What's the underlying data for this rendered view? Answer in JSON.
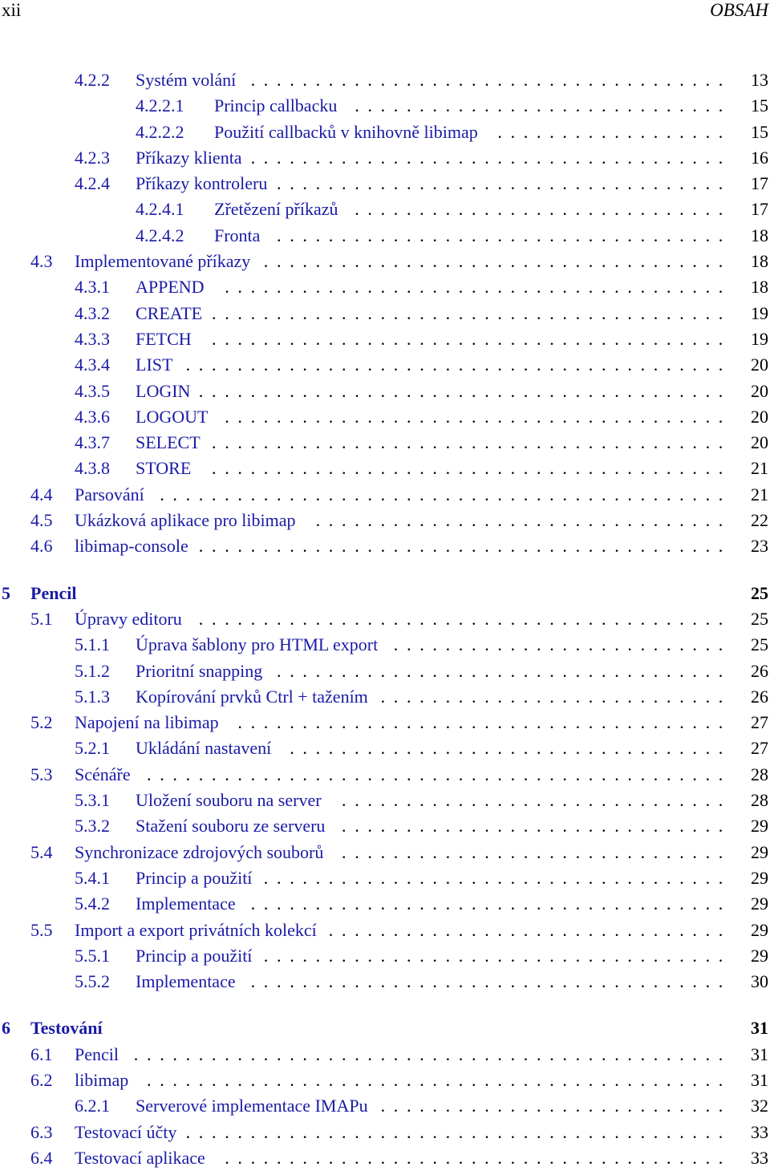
{
  "header": {
    "page_number": "xii",
    "running_title": "OBSAH"
  },
  "toc": [
    {
      "level": 3,
      "num": "4.2.2",
      "title": "Systém volání",
      "page": "13"
    },
    {
      "level": 4,
      "num": "4.2.2.1",
      "title": "Princip callbacku",
      "page": "15"
    },
    {
      "level": 4,
      "num": "4.2.2.2",
      "title": "Použití callbacků v knihovně libimap",
      "page": "15"
    },
    {
      "level": 3,
      "num": "4.2.3",
      "title": "Příkazy klienta",
      "page": "16"
    },
    {
      "level": 3,
      "num": "4.2.4",
      "title": "Příkazy kontroleru",
      "page": "17"
    },
    {
      "level": 4,
      "num": "4.2.4.1",
      "title": "Zřetězení příkazů",
      "page": "17"
    },
    {
      "level": 4,
      "num": "4.2.4.2",
      "title": "Fronta",
      "page": "18"
    },
    {
      "level": 2,
      "num": "4.3",
      "title": "Implementované příkazy",
      "page": "18"
    },
    {
      "level": 3,
      "num": "4.3.1",
      "title": "APPEND",
      "page": "18"
    },
    {
      "level": 3,
      "num": "4.3.2",
      "title": "CREATE",
      "page": "19"
    },
    {
      "level": 3,
      "num": "4.3.3",
      "title": "FETCH",
      "page": "19"
    },
    {
      "level": 3,
      "num": "4.3.4",
      "title": "LIST",
      "page": "20"
    },
    {
      "level": 3,
      "num": "4.3.5",
      "title": "LOGIN",
      "page": "20"
    },
    {
      "level": 3,
      "num": "4.3.6",
      "title": "LOGOUT",
      "page": "20"
    },
    {
      "level": 3,
      "num": "4.3.7",
      "title": "SELECT",
      "page": "20"
    },
    {
      "level": 3,
      "num": "4.3.8",
      "title": "STORE",
      "page": "21"
    },
    {
      "level": 2,
      "num": "4.4",
      "title": "Parsování",
      "page": "21"
    },
    {
      "level": 2,
      "num": "4.5",
      "title": "Ukázková aplikace pro libimap",
      "page": "22"
    },
    {
      "level": 2,
      "num": "4.6",
      "title": "libimap-console",
      "page": "23"
    },
    {
      "level": 1,
      "num": "5",
      "title": "Pencil",
      "page": "25"
    },
    {
      "level": 2,
      "num": "5.1",
      "title": "Úpravy editoru",
      "page": "25"
    },
    {
      "level": 3,
      "num": "5.1.1",
      "title": "Úprava šablony pro HTML export",
      "page": "25"
    },
    {
      "level": 3,
      "num": "5.1.2",
      "title": "Prioritní snapping",
      "page": "26"
    },
    {
      "level": 3,
      "num": "5.1.3",
      "title": "Kopírování prvků Ctrl + tažením",
      "page": "26"
    },
    {
      "level": 2,
      "num": "5.2",
      "title": "Napojení na libimap",
      "page": "27"
    },
    {
      "level": 3,
      "num": "5.2.1",
      "title": "Ukládání nastavení",
      "page": "27"
    },
    {
      "level": 2,
      "num": "5.3",
      "title": "Scénáře",
      "page": "28"
    },
    {
      "level": 3,
      "num": "5.3.1",
      "title": "Uložení souboru na server",
      "page": "28"
    },
    {
      "level": 3,
      "num": "5.3.2",
      "title": "Stažení souboru ze serveru",
      "page": "29"
    },
    {
      "level": 2,
      "num": "5.4",
      "title": "Synchronizace zdrojových souborů",
      "page": "29"
    },
    {
      "level": 3,
      "num": "5.4.1",
      "title": "Princip a použití",
      "page": "29"
    },
    {
      "level": 3,
      "num": "5.4.2",
      "title": "Implementace",
      "page": "29"
    },
    {
      "level": 2,
      "num": "5.5",
      "title": "Import a export privátních kolekcí",
      "page": "29"
    },
    {
      "level": 3,
      "num": "5.5.1",
      "title": "Princip a použití",
      "page": "29"
    },
    {
      "level": 3,
      "num": "5.5.2",
      "title": "Implementace",
      "page": "30"
    },
    {
      "level": 1,
      "num": "6",
      "title": "Testování",
      "page": "31"
    },
    {
      "level": 2,
      "num": "6.1",
      "title": "Pencil",
      "page": "31"
    },
    {
      "level": 2,
      "num": "6.2",
      "title": "libimap",
      "page": "31"
    },
    {
      "level": 3,
      "num": "6.2.1",
      "title": "Serverové implementace IMAPu",
      "page": "32"
    },
    {
      "level": 2,
      "num": "6.3",
      "title": "Testovací účty",
      "page": "33"
    },
    {
      "level": 2,
      "num": "6.4",
      "title": "Testovací aplikace",
      "page": "33"
    }
  ],
  "colors": {
    "link": "#1a1aa6",
    "text": "#000000"
  }
}
